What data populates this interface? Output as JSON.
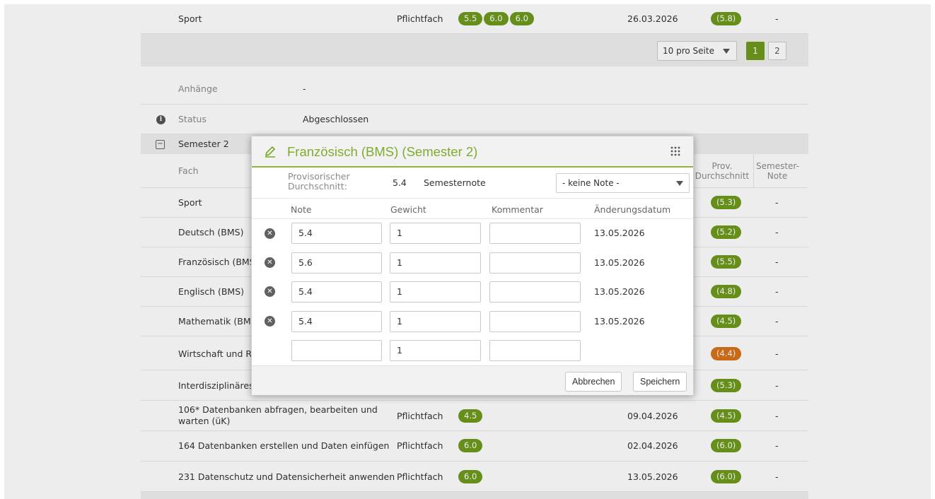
{
  "top_row": {
    "subject": "Sport",
    "type": "Pflichtfach",
    "grades": [
      "5.5",
      "6.0",
      "6.0"
    ],
    "date": "26.03.2026",
    "avg": "(5.8)",
    "semester": "-"
  },
  "pager": {
    "per_page": "10 pro Seite",
    "pages": [
      "1",
      "2"
    ]
  },
  "details": {
    "attachments_label": "Anhänge",
    "attachments_value": "-",
    "status_label": "Status",
    "status_value": "Abgeschlossen"
  },
  "semester2": {
    "title": "Semester 2",
    "columns": {
      "subject": "Fach",
      "avg": "Prov. Durchschnitt",
      "semester": "Semester- Note"
    },
    "rows": [
      {
        "subject": "Sport",
        "avg": "(5.3)",
        "semester": "-"
      },
      {
        "subject": "Deutsch (BMS)",
        "avg": "(5.2)",
        "semester": "-"
      },
      {
        "subject": "Französisch (BMS)",
        "avg": "(5.5)",
        "semester": "-"
      },
      {
        "subject": "Englisch (BMS)",
        "avg": "(4.8)",
        "semester": "-"
      },
      {
        "subject": "Mathematik (BMS)",
        "avg": "(4.5)",
        "semester": "-"
      },
      {
        "subject": "Wirtschaft und Re",
        "avg": "(4.4)",
        "semester": "-"
      },
      {
        "subject": "Interdisziplinäres",
        "avg": "(5.3)",
        "semester": "-"
      }
    ],
    "lower_rows": [
      {
        "subject": "106* Datenbanken abfragen, bearbeiten und warten (üK)",
        "type": "Pflichtfach",
        "grade": "4.5",
        "date": "09.04.2026",
        "avg": "(4.5)",
        "semester": "-"
      },
      {
        "subject": "164 Datenbanken erstellen und Daten einfügen",
        "type": "Pflichtfach",
        "grade": "6.0",
        "date": "02.04.2026",
        "avg": "(6.0)",
        "semester": "-"
      },
      {
        "subject": "231 Datenschutz und Datensicherheit anwenden",
        "type": "Pflichtfach",
        "grade": "6.0",
        "date": "13.05.2026",
        "avg": "(6.0)",
        "semester": "-"
      }
    ]
  },
  "modal": {
    "title": "Französisch (BMS) (Semester 2)",
    "prov_label": "Provisorischer Durchschnitt:",
    "prov_value": "5.4",
    "semester_label": "Semesternote",
    "semester_select": "- keine Note -",
    "columns": {
      "note": "Note",
      "weight": "Gewicht",
      "comment": "Kommentar",
      "date": "Änderungsdatum"
    },
    "entries": [
      {
        "note": "5.4",
        "weight": "1",
        "comment": "",
        "date": "13.05.2026"
      },
      {
        "note": "5.6",
        "weight": "1",
        "comment": "",
        "date": "13.05.2026"
      },
      {
        "note": "5.4",
        "weight": "1",
        "comment": "",
        "date": "13.05.2026"
      },
      {
        "note": "5.4",
        "weight": "1",
        "comment": "",
        "date": "13.05.2026"
      }
    ],
    "new_entry": {
      "note": "",
      "weight": "1",
      "comment": ""
    },
    "cancel": "Abbrechen",
    "save": "Speichern"
  },
  "colors": {
    "accent": "#6e9a1c",
    "title_green": "#7fac2c",
    "warning": "#d9731a"
  }
}
